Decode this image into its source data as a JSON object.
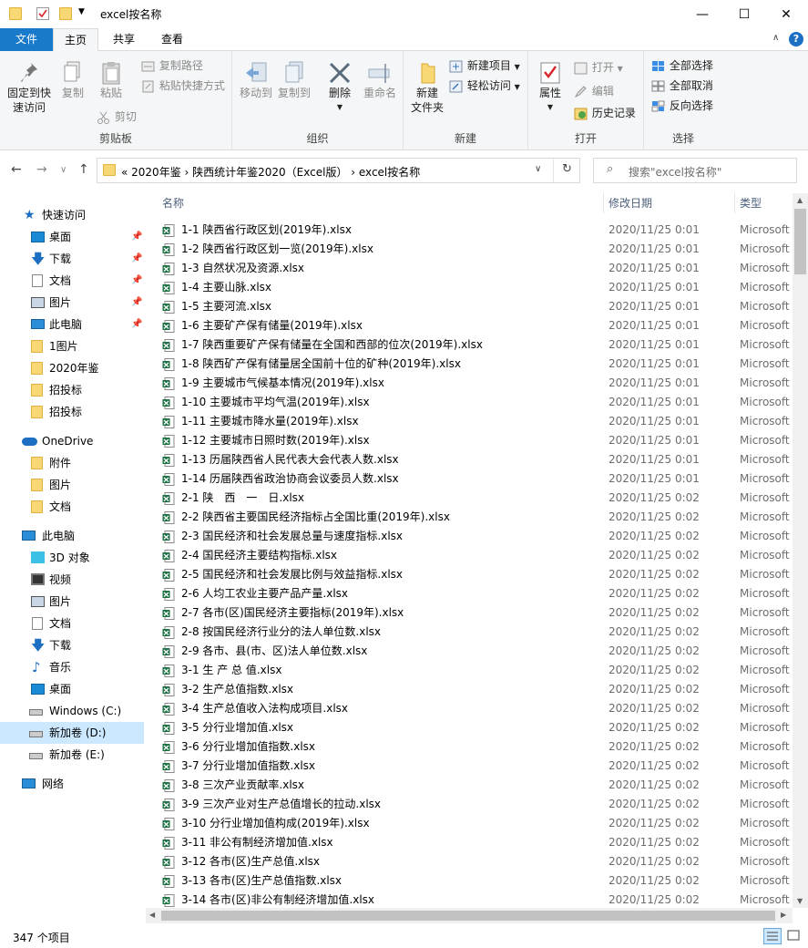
{
  "window": {
    "title": "excel按名称",
    "minimize": "—",
    "maximize": "☐",
    "close": "✕"
  },
  "ribbon_tabs": {
    "file": "文件",
    "home": "主页",
    "share": "共享",
    "view": "查看",
    "collapse": "∧"
  },
  "ribbon": {
    "clipboard": {
      "pin": "固定到快\n速访问",
      "copy": "复制",
      "paste": "粘贴",
      "copy_path": "复制路径",
      "paste_shortcut": "粘贴快捷方式",
      "cut": "剪切",
      "label": "剪贴板"
    },
    "organize": {
      "move_to": "移动到",
      "copy_to": "复制到",
      "delete": "删除",
      "rename": "重命名",
      "label": "组织"
    },
    "new": {
      "new_folder": "新建\n文件夹",
      "new_item": "新建项目",
      "easy_access": "轻松访问",
      "label": "新建"
    },
    "open": {
      "properties": "属性",
      "open": "打开",
      "edit": "编辑",
      "history": "历史记录",
      "label": "打开"
    },
    "select": {
      "select_all": "全部选择",
      "select_none": "全部取消",
      "invert": "反向选择",
      "label": "选择"
    }
  },
  "address": {
    "crumbs": "«   2020年鉴   ›   陕西统计年鉴2020（Excel版）   ›   excel按名称",
    "search_placeholder": "搜索\"excel按名称\""
  },
  "nav_pane": {
    "quick_access": "快速访问",
    "desktop": "桌面",
    "downloads": "下载",
    "documents": "文档",
    "pictures": "图片",
    "this_pc": "此电脑",
    "f_1tupian": "1图片",
    "f_2020": "2020年鉴",
    "f_zhaobiao1": "招投标",
    "f_zhaobiao2": "招投标",
    "onedrive": "OneDrive",
    "od_attach": "附件",
    "od_pics": "图片",
    "od_docs": "文档",
    "pc": "此电脑",
    "pc_3d": "3D 对象",
    "pc_video": "视频",
    "pc_pics": "图片",
    "pc_docs": "文档",
    "pc_down": "下载",
    "pc_music": "音乐",
    "pc_desk": "桌面",
    "drive_c": "Windows (C:)",
    "drive_d": "新加卷 (D:)",
    "drive_e": "新加卷 (E:)",
    "network": "网络"
  },
  "columns": {
    "name": "名称",
    "date": "修改日期",
    "type": "类型"
  },
  "files": [
    {
      "name": "1-1  陕西省行政区划(2019年).xlsx",
      "date": "2020/11/25 0:01",
      "type": "Microsoft"
    },
    {
      "name": "1-2  陕西省行政区划一览(2019年).xlsx",
      "date": "2020/11/25 0:01",
      "type": "Microsoft"
    },
    {
      "name": "1-3  自然状况及资源.xlsx",
      "date": "2020/11/25 0:01",
      "type": "Microsoft"
    },
    {
      "name": "1-4  主要山脉.xlsx",
      "date": "2020/11/25 0:01",
      "type": "Microsoft"
    },
    {
      "name": "1-5  主要河流.xlsx",
      "date": "2020/11/25 0:01",
      "type": "Microsoft"
    },
    {
      "name": "1-6  主要矿产保有储量(2019年).xlsx",
      "date": "2020/11/25 0:01",
      "type": "Microsoft"
    },
    {
      "name": "1-7  陕西重要矿产保有储量在全国和西部的位次(2019年).xlsx",
      "date": "2020/11/25 0:01",
      "type": "Microsoft"
    },
    {
      "name": "1-8  陕西矿产保有储量居全国前十位的矿种(2019年).xlsx",
      "date": "2020/11/25 0:01",
      "type": "Microsoft"
    },
    {
      "name": "1-9  主要城市气候基本情况(2019年).xlsx",
      "date": "2020/11/25 0:01",
      "type": "Microsoft"
    },
    {
      "name": "1-10  主要城市平均气温(2019年).xlsx",
      "date": "2020/11/25 0:01",
      "type": "Microsoft"
    },
    {
      "name": "1-11  主要城市降水量(2019年).xlsx",
      "date": "2020/11/25 0:01",
      "type": "Microsoft"
    },
    {
      "name": "1-12  主要城市日照时数(2019年).xlsx",
      "date": "2020/11/25 0:01",
      "type": "Microsoft"
    },
    {
      "name": "1-13  历届陕西省人民代表大会代表人数.xlsx",
      "date": "2020/11/25 0:01",
      "type": "Microsoft"
    },
    {
      "name": "1-14  历届陕西省政治协商会议委员人数.xlsx",
      "date": "2020/11/25 0:01",
      "type": "Microsoft"
    },
    {
      "name": "2-1  陕　西　一　日.xlsx",
      "date": "2020/11/25 0:02",
      "type": "Microsoft"
    },
    {
      "name": "2-2  陕西省主要国民经济指标占全国比重(2019年).xlsx",
      "date": "2020/11/25 0:02",
      "type": "Microsoft"
    },
    {
      "name": "2-3  国民经济和社会发展总量与速度指标.xlsx",
      "date": "2020/11/25 0:02",
      "type": "Microsoft"
    },
    {
      "name": "2-4  国民经济主要结构指标.xlsx",
      "date": "2020/11/25 0:02",
      "type": "Microsoft"
    },
    {
      "name": "2-5  国民经济和社会发展比例与效益指标.xlsx",
      "date": "2020/11/25 0:02",
      "type": "Microsoft"
    },
    {
      "name": "2-6  人均工农业主要产品产量.xlsx",
      "date": "2020/11/25 0:02",
      "type": "Microsoft"
    },
    {
      "name": "2-7  各市(区)国民经济主要指标(2019年).xlsx",
      "date": "2020/11/25 0:02",
      "type": "Microsoft"
    },
    {
      "name": "2-8  按国民经济行业分的法人单位数.xlsx",
      "date": "2020/11/25 0:02",
      "type": "Microsoft"
    },
    {
      "name": "2-9  各市、县(市、区)法人单位数.xlsx",
      "date": "2020/11/25 0:02",
      "type": "Microsoft"
    },
    {
      "name": "3-1  生 产 总 值.xlsx",
      "date": "2020/11/25 0:02",
      "type": "Microsoft"
    },
    {
      "name": "3-2  生产总值指数.xlsx",
      "date": "2020/11/25 0:02",
      "type": "Microsoft"
    },
    {
      "name": "3-4  生产总值收入法构成项目.xlsx",
      "date": "2020/11/25 0:02",
      "type": "Microsoft"
    },
    {
      "name": "3-5  分行业增加值.xlsx",
      "date": "2020/11/25 0:02",
      "type": "Microsoft"
    },
    {
      "name": "3-6  分行业增加值指数.xlsx",
      "date": "2020/11/25 0:02",
      "type": "Microsoft"
    },
    {
      "name": "3-7  分行业增加值指数.xlsx",
      "date": "2020/11/25 0:02",
      "type": "Microsoft"
    },
    {
      "name": "3-8  三次产业贡献率.xlsx",
      "date": "2020/11/25 0:02",
      "type": "Microsoft"
    },
    {
      "name": "3-9  三次产业对生产总值增长的拉动.xlsx",
      "date": "2020/11/25 0:02",
      "type": "Microsoft"
    },
    {
      "name": "3-10  分行业增加值构成(2019年).xlsx",
      "date": "2020/11/25 0:02",
      "type": "Microsoft"
    },
    {
      "name": "3-11  非公有制经济增加值.xlsx",
      "date": "2020/11/25 0:02",
      "type": "Microsoft"
    },
    {
      "name": "3-12  各市(区)生产总值.xlsx",
      "date": "2020/11/25 0:02",
      "type": "Microsoft"
    },
    {
      "name": "3-13  各市(区)生产总值指数.xlsx",
      "date": "2020/11/25 0:02",
      "type": "Microsoft"
    },
    {
      "name": "3-14  各市(区)非公有制经济增加值.xlsx",
      "date": "2020/11/25 0:02",
      "type": "Microsoft"
    }
  ],
  "status": {
    "count": "347 个项目"
  },
  "colors": {
    "accent": "#1979ca",
    "selection": "#cce8ff",
    "folder": "#f8d775",
    "excel": "#1e7145"
  }
}
